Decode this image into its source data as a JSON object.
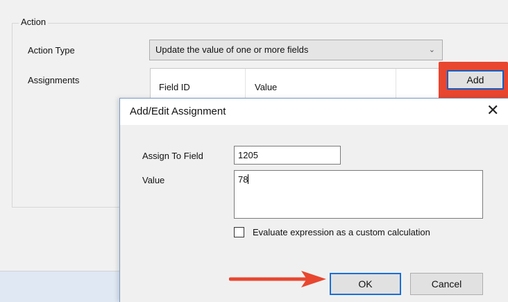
{
  "action_group": {
    "legend": "Action",
    "action_type_label": "Action Type",
    "action_type_value": "Update the value of one or more fields",
    "assignments_label": "Assignments",
    "columns": [
      "Field ID",
      "Value"
    ],
    "add_label": "Add"
  },
  "dialog": {
    "title": "Add/Edit Assignment",
    "assign_to_field_label": "Assign To Field",
    "assign_to_field_value": "1205",
    "value_label": "Value",
    "value_text": "78",
    "checkbox_label": "Evaluate expression as a custom calculation",
    "checkbox_checked": false,
    "ok_label": "OK",
    "cancel_label": "Cancel"
  },
  "annotations": {
    "highlight_color": "#e8462f",
    "arrow_color": "#e8462f"
  }
}
